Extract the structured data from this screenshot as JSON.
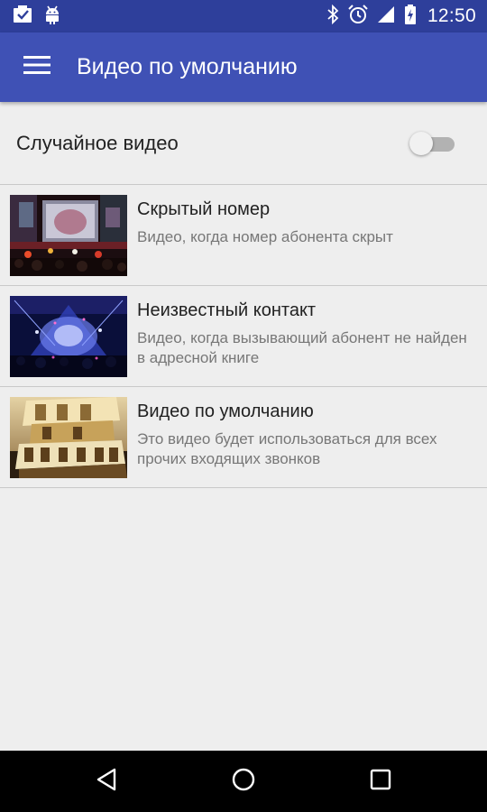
{
  "status_bar": {
    "time": "12:50",
    "left_icons": [
      "inbox-check-icon",
      "android-debug-icon"
    ],
    "right_icons": [
      "bluetooth-icon",
      "alarm-icon",
      "signal-icon",
      "battery-icon"
    ]
  },
  "app_bar": {
    "title": "Видео по умолчанию",
    "background": "#3f51b5",
    "status_background": "#2e3f9b"
  },
  "random_video": {
    "label": "Случайное видео",
    "enabled": false
  },
  "videos": [
    {
      "title": "Скрытый номер",
      "description": "Видео, когда номер абонента скрыт",
      "thumbnail": "concert-stage-thumbnail"
    },
    {
      "title": "Неизвестный контакт",
      "description": "Видео, когда вызывающий абонент не найден в адресной книге",
      "thumbnail": "blue-stage-thumbnail"
    },
    {
      "title": "Видео по умолчанию",
      "description": "Это видео будет использоваться для всех прочих входящих звонков",
      "thumbnail": "the-phone-logo-thumbnail"
    }
  ],
  "nav_bar": {
    "buttons": [
      "back-icon",
      "home-icon",
      "recents-icon"
    ]
  }
}
